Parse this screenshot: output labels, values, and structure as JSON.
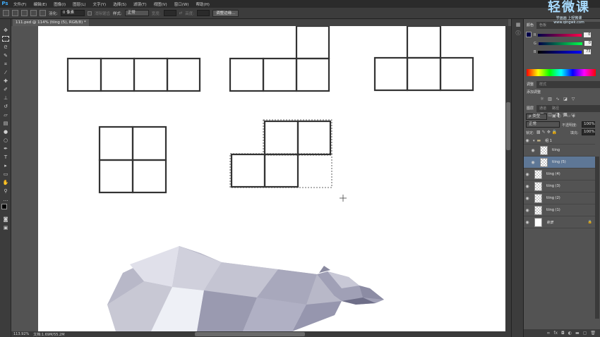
{
  "app": {
    "logo": "Ps"
  },
  "menu": [
    "文件(F)",
    "编辑(E)",
    "图像(I)",
    "图层(L)",
    "文字(Y)",
    "选择(S)",
    "滤镜(T)",
    "视图(V)",
    "窗口(W)",
    "帮助(H)"
  ],
  "options_bar": {
    "feather_label": "羽化:",
    "feather_value": "0 像素",
    "antialias_label": "消除锯齿",
    "style_label": "样式:",
    "style_value": "正常",
    "width_label": "宽度:",
    "height_label": "高度:",
    "refine_edge": "调整边缘..."
  },
  "document": {
    "tab_title": "111.psd @ 114% (tiing (5), RGB/8) *"
  },
  "status": {
    "zoom": "113.92%",
    "doc_info": "文档:1.69M/55.2M"
  },
  "watermark": {
    "brand": "轻微课",
    "slogan": "学画画 上轻微课",
    "url": "www.qingwk.com"
  },
  "color_panel": {
    "tabs": [
      "颜色",
      "色板"
    ],
    "R": "0",
    "G": "0",
    "B": "73",
    "pct": "%"
  },
  "adjust_panel": {
    "tabs": [
      "调整",
      "样式"
    ],
    "title": "添加调整"
  },
  "layers_panel": {
    "tabs": [
      "图层",
      "通道",
      "路径"
    ],
    "kind": "ρ 类型",
    "blend": "正常",
    "opacity_label": "不透明度:",
    "opacity_value": "100%",
    "lock_label": "锁定:",
    "fill_label": "填充:",
    "fill_value": "100%",
    "group": "组 1",
    "layers": [
      "tiing",
      "tiing (5)",
      "tiing (4)",
      "tiing (3)",
      "tiing (2)",
      "tiing (1)",
      "背景"
    ]
  }
}
